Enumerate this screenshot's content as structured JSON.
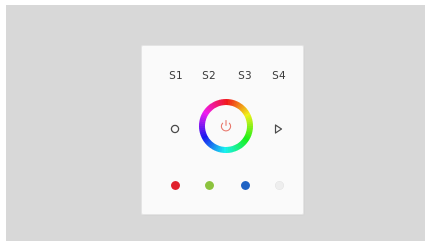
{
  "scenes": [
    {
      "label": "S1"
    },
    {
      "label": "S2"
    },
    {
      "label": "S3"
    },
    {
      "label": "S4"
    }
  ],
  "power": {
    "icon": "power-icon",
    "color": "#e8766a"
  },
  "ring": {
    "icon": "color-wheel"
  },
  "left_button": {
    "icon": "circle-outline-icon"
  },
  "right_button": {
    "icon": "play-outline-icon"
  },
  "color_buttons": [
    {
      "name": "red",
      "color": "#e0202c"
    },
    {
      "name": "green",
      "color": "#8cc33e"
    },
    {
      "name": "blue",
      "color": "#1f63c4"
    },
    {
      "name": "white",
      "color": "#eeeeee"
    }
  ],
  "colors": {
    "background": "#d8d8d8",
    "panel": "#fafafa",
    "label": "#3c3c3c"
  }
}
